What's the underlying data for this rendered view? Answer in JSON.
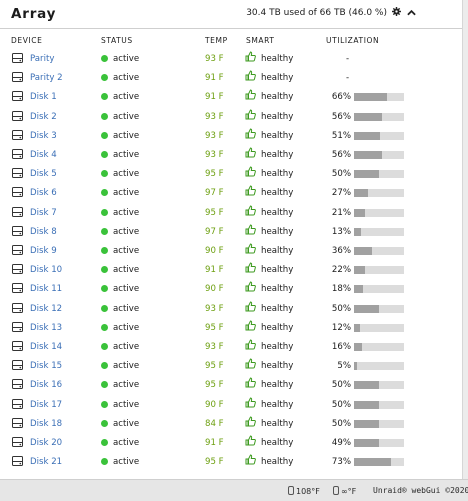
{
  "header": {
    "title": "Array",
    "summary": "30.4 TB used of 66 TB (46.0 %)",
    "gear_icon": "gear-icon",
    "collapse_icon": "chevron-up-icon"
  },
  "columns": {
    "device": "DEVICE",
    "status": "STATUS",
    "temp": "TEMP",
    "smart": "SMART",
    "utilization": "UTILIZATION"
  },
  "colors": {
    "status_active": "#3ac23a",
    "temp": "#6ea012",
    "link": "#3b6fb6",
    "bar_fill": "#a1a1a1",
    "bar_bg": "#dcdcdc"
  },
  "rows": [
    {
      "device": "Parity",
      "status": "active",
      "temp": "93 F",
      "smart": "healthy",
      "util": "-",
      "util_frac": null
    },
    {
      "device": "Parity 2",
      "status": "active",
      "temp": "91 F",
      "smart": "healthy",
      "util": "-",
      "util_frac": null
    },
    {
      "device": "Disk 1",
      "status": "active",
      "temp": "91 F",
      "smart": "healthy",
      "util": "66%",
      "util_frac": 0.66
    },
    {
      "device": "Disk 2",
      "status": "active",
      "temp": "93 F",
      "smart": "healthy",
      "util": "56%",
      "util_frac": 0.56
    },
    {
      "device": "Disk 3",
      "status": "active",
      "temp": "93 F",
      "smart": "healthy",
      "util": "51%",
      "util_frac": 0.51
    },
    {
      "device": "Disk 4",
      "status": "active",
      "temp": "93 F",
      "smart": "healthy",
      "util": "56%",
      "util_frac": 0.56
    },
    {
      "device": "Disk 5",
      "status": "active",
      "temp": "95 F",
      "smart": "healthy",
      "util": "50%",
      "util_frac": 0.5
    },
    {
      "device": "Disk 6",
      "status": "active",
      "temp": "97 F",
      "smart": "healthy",
      "util": "27%",
      "util_frac": 0.27
    },
    {
      "device": "Disk 7",
      "status": "active",
      "temp": "95 F",
      "smart": "healthy",
      "util": "21%",
      "util_frac": 0.21
    },
    {
      "device": "Disk 8",
      "status": "active",
      "temp": "97 F",
      "smart": "healthy",
      "util": "13%",
      "util_frac": 0.13
    },
    {
      "device": "Disk 9",
      "status": "active",
      "temp": "90 F",
      "smart": "healthy",
      "util": "36%",
      "util_frac": 0.36
    },
    {
      "device": "Disk 10",
      "status": "active",
      "temp": "91 F",
      "smart": "healthy",
      "util": "22%",
      "util_frac": 0.22
    },
    {
      "device": "Disk 11",
      "status": "active",
      "temp": "90 F",
      "smart": "healthy",
      "util": "18%",
      "util_frac": 0.18
    },
    {
      "device": "Disk 12",
      "status": "active",
      "temp": "93 F",
      "smart": "healthy",
      "util": "50%",
      "util_frac": 0.5
    },
    {
      "device": "Disk 13",
      "status": "active",
      "temp": "95 F",
      "smart": "healthy",
      "util": "12%",
      "util_frac": 0.12
    },
    {
      "device": "Disk 14",
      "status": "active",
      "temp": "93 F",
      "smart": "healthy",
      "util": "16%",
      "util_frac": 0.16
    },
    {
      "device": "Disk 15",
      "status": "active",
      "temp": "95 F",
      "smart": "healthy",
      "util": "5%",
      "util_frac": 0.05
    },
    {
      "device": "Disk 16",
      "status": "active",
      "temp": "95 F",
      "smart": "healthy",
      "util": "50%",
      "util_frac": 0.5
    },
    {
      "device": "Disk 17",
      "status": "active",
      "temp": "90 F",
      "smart": "healthy",
      "util": "50%",
      "util_frac": 0.5
    },
    {
      "device": "Disk 18",
      "status": "active",
      "temp": "84 F",
      "smart": "healthy",
      "util": "50%",
      "util_frac": 0.5
    },
    {
      "device": "Disk 20",
      "status": "active",
      "temp": "91 F",
      "smart": "healthy",
      "util": "49%",
      "util_frac": 0.49
    },
    {
      "device": "Disk 21",
      "status": "active",
      "temp": "95 F",
      "smart": "healthy",
      "util": "73%",
      "util_frac": 0.73
    }
  ],
  "footer": {
    "temp1": "108°F",
    "temp2": "∞°F",
    "copyright": "Unraid® webGui ©2020,"
  }
}
